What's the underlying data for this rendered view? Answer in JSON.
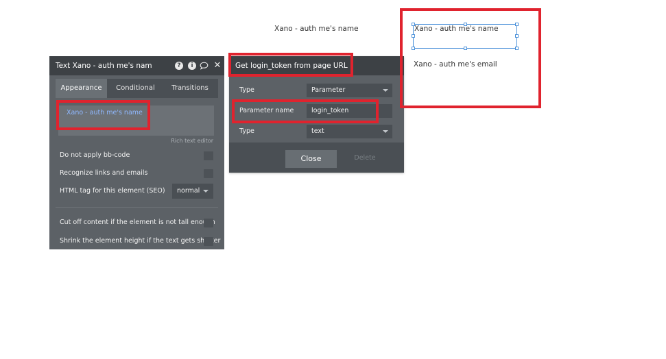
{
  "canvas": {
    "floating_text": "Xano - auth me's name",
    "selected_text": "Xano - auth me's name",
    "email_text": "Xano - auth me's email"
  },
  "property_panel": {
    "title": "Text Xano - auth me's nam",
    "header_icons": [
      "help-icon",
      "info-icon",
      "comment-icon",
      "close-icon"
    ],
    "tabs": [
      {
        "label": "Appearance",
        "active": true
      },
      {
        "label": "Conditional",
        "active": false
      },
      {
        "label": "Transitions",
        "active": false
      }
    ],
    "rich_text_content": "Xano - auth me's name",
    "rich_text_label": "Rich text editor",
    "options": [
      {
        "label": "Do not apply bb-code",
        "checked": false
      },
      {
        "label": "Recognize links and emails",
        "checked": false
      }
    ],
    "html_tag": {
      "label": "HTML tag for this element (SEO)",
      "value": "normal"
    },
    "options2": [
      {
        "label": "Cut off content if the element is not tall enough",
        "checked": false
      },
      {
        "label": "Shrink the element height if the text gets shorter",
        "checked": false
      }
    ]
  },
  "url_dialog": {
    "title": "Get login_token from page URL",
    "rows": [
      {
        "label": "Type",
        "value": "Parameter"
      },
      {
        "label": "Parameter name",
        "value": "login_token"
      },
      {
        "label": "Type",
        "value": "text"
      }
    ],
    "close_label": "Close",
    "delete_label": "Delete"
  },
  "colors": {
    "annotation_red": "#e0232e",
    "panel_bg": "#5c6166",
    "header_bg": "#3d4145",
    "link_blue": "#8fb8ff",
    "selection_blue": "#4a90d9"
  }
}
